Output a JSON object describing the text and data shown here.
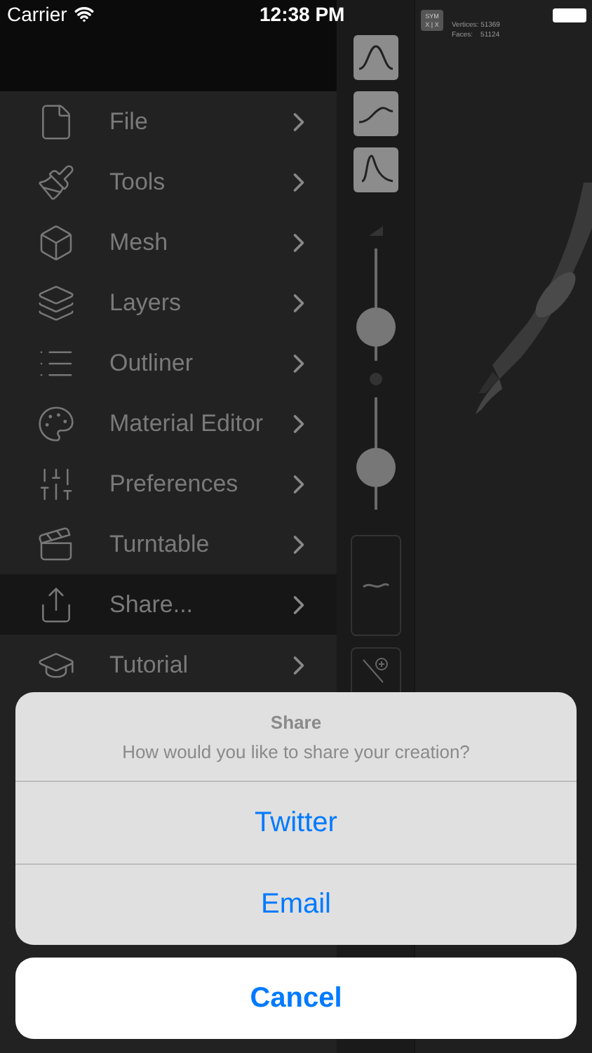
{
  "status_bar": {
    "carrier": "Carrier",
    "time": "12:38 PM"
  },
  "menu": [
    {
      "label": "File",
      "selected": false
    },
    {
      "label": "Tools",
      "selected": false
    },
    {
      "label": "Mesh",
      "selected": false
    },
    {
      "label": "Layers",
      "selected": false
    },
    {
      "label": "Outliner",
      "selected": false
    },
    {
      "label": "Material Editor",
      "selected": false
    },
    {
      "label": "Preferences",
      "selected": false
    },
    {
      "label": "Turntable",
      "selected": false
    },
    {
      "label": "Share...",
      "selected": true
    },
    {
      "label": "Tutorial",
      "selected": false
    }
  ],
  "toolbar": {
    "sliders": [
      {
        "level": 0.3
      },
      {
        "level": 0.38
      }
    ]
  },
  "canvas": {
    "sym_top": "SYM",
    "sym_bottom": "X | X",
    "vertices": "Vertices: 51369",
    "faces": "Faces:    51124"
  },
  "action_sheet": {
    "title": "Share",
    "message": "How would you like to share your creation?",
    "actions": [
      "Twitter",
      "Email"
    ],
    "cancel": "Cancel"
  }
}
